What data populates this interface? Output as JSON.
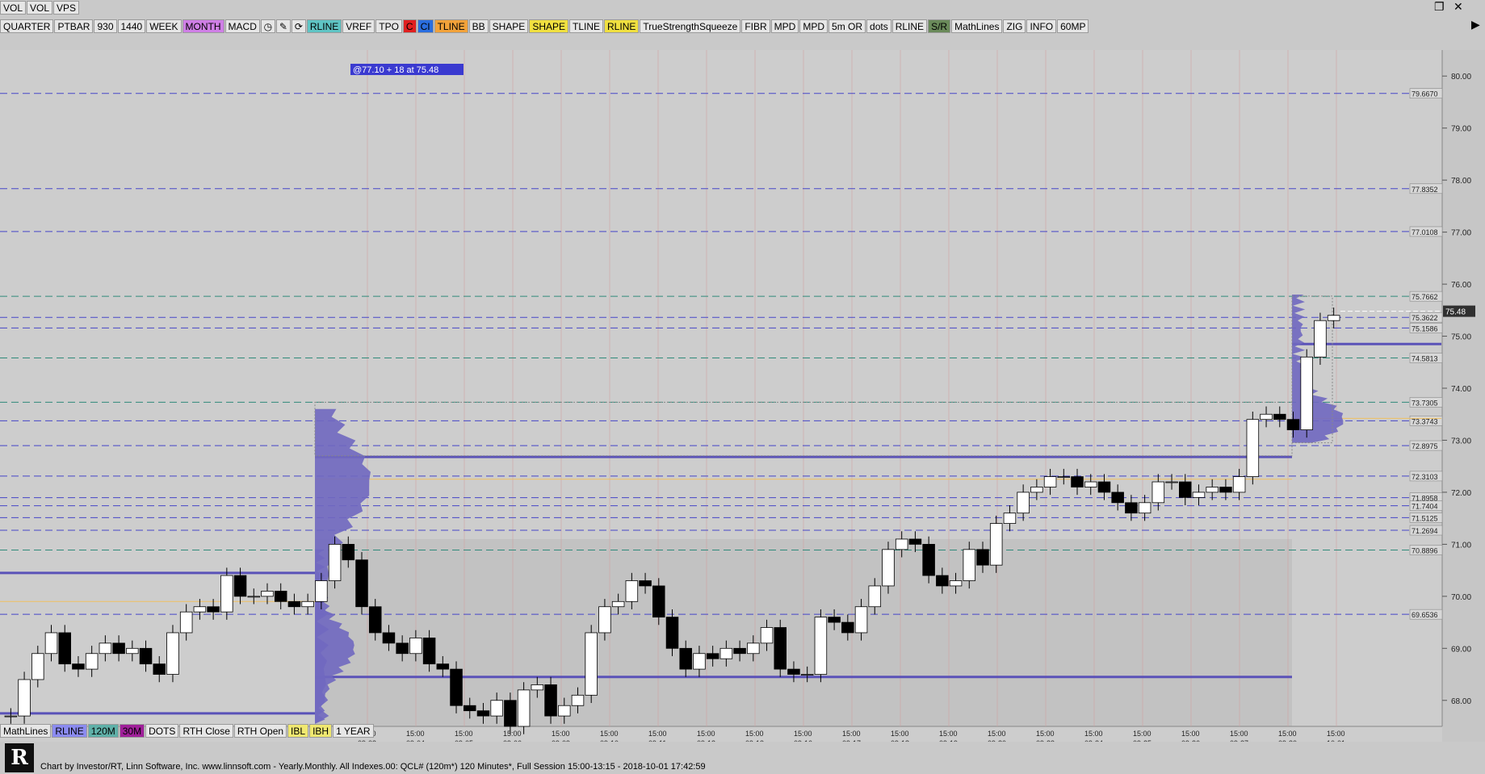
{
  "top_tabs": [
    "VOL",
    "VOL",
    "VPS"
  ],
  "toolbar": [
    {
      "label": "QUARTER",
      "color": "#e6e6e6"
    },
    {
      "label": "PTBAR",
      "color": "#e6e6e6"
    },
    {
      "label": "930",
      "color": "#e6e6e6"
    },
    {
      "label": "1440",
      "color": "#e6e6e6"
    },
    {
      "label": "WEEK",
      "color": "#e6e6e6"
    },
    {
      "label": "MONTH",
      "color": "#cf7fe6"
    },
    {
      "label": "MACD",
      "color": "#e6e6e6"
    },
    {
      "label": "",
      "color": "#e6e6e6",
      "icon": "clock-icon",
      "glyph": "◷"
    },
    {
      "label": "",
      "color": "#e6e6e6",
      "icon": "pencil-icon",
      "glyph": "✎"
    },
    {
      "label": "",
      "color": "#e6e6e6",
      "icon": "refresh-icon",
      "glyph": "⟳"
    },
    {
      "label": "RLINE",
      "color": "#5fc4c4"
    },
    {
      "label": "VREF",
      "color": "#e6e6e6"
    },
    {
      "label": "TPO",
      "color": "#e6e6e6"
    },
    {
      "label": "C",
      "color": "#e02020"
    },
    {
      "label": "CI",
      "color": "#2a6ee0"
    },
    {
      "label": "TLINE",
      "color": "#f2a23a"
    },
    {
      "label": "BB",
      "color": "#e6e6e6"
    },
    {
      "label": "SHAPE",
      "color": "#e6e6e6"
    },
    {
      "label": "SHAPE",
      "color": "#f0e040"
    },
    {
      "label": "TLINE",
      "color": "#e6e6e6"
    },
    {
      "label": "RLINE",
      "color": "#f0e040"
    },
    {
      "label": "TrueStrengthSqueeze",
      "color": "#e6e6e6"
    },
    {
      "label": "FIBR",
      "color": "#e6e6e6"
    },
    {
      "label": "MPD",
      "color": "#e6e6e6"
    },
    {
      "label": "MPD",
      "color": "#e6e6e6"
    },
    {
      "label": "5m OR",
      "color": "#e6e6e6"
    },
    {
      "label": "dots",
      "color": "#e6e6e6"
    },
    {
      "label": "RLINE",
      "color": "#e6e6e6"
    },
    {
      "label": "S/R",
      "color": "#6a8a5a"
    },
    {
      "label": "MathLines",
      "color": "#e6e6e6"
    },
    {
      "label": "ZIG",
      "color": "#e6e6e6"
    },
    {
      "label": "INFO",
      "color": "#e6e6e6"
    },
    {
      "label": "60MP",
      "color": "#e6e6e6"
    }
  ],
  "bottom_toolbar": [
    {
      "label": "MathLines",
      "color": "#e6e6e6"
    },
    {
      "label": "RLINE",
      "color": "#8b8bf0"
    },
    {
      "label": "120M",
      "color": "#5fb0a8"
    },
    {
      "label": "30M",
      "color": "#a0209a"
    },
    {
      "label": "DOTS",
      "color": "#e6e6e6"
    },
    {
      "label": "RTH Close",
      "color": "#e6e6e6"
    },
    {
      "label": "RTH Open",
      "color": "#e6e6e6"
    },
    {
      "label": "IBL",
      "color": "#f0e870"
    },
    {
      "label": "IBH",
      "color": "#f0e870"
    },
    {
      "label": "1 YEAR",
      "color": "#e6e6e6"
    }
  ],
  "annotation": "@77.10  + 18 at 75.48",
  "last_price": "75.48",
  "colors": {
    "chart_bg_upper": "#cdcdcd",
    "chart_bg_lower": "#c2c2c2",
    "dashed_blue": "#4646c8",
    "dashed_teal": "#2f8a7a",
    "profile": "#7068c0",
    "level_line": "#5a52b8",
    "poc_line": "#f0c060"
  },
  "chart_data": {
    "type": "candlestick",
    "title": "",
    "ylim": [
      67.5,
      80.5
    ],
    "y_ticks": [
      "68.00",
      "69.00",
      "70.00",
      "71.00",
      "72.00",
      "73.00",
      "74.00",
      "75.00",
      "76.00",
      "77.00",
      "78.00",
      "79.00",
      "80.00"
    ],
    "levels_blue": [
      "79.6670",
      "77.8352",
      "77.0108",
      "75.3622",
      "75.1586",
      "73.3743",
      "72.8975",
      "72.3103",
      "71.8958",
      "71.7404",
      "71.5125",
      "71.2694",
      "69.6536"
    ],
    "levels_teal": [
      "75.7662",
      "74.5813",
      "73.7305",
      "70.8896"
    ],
    "date_labels": [
      "09-03",
      "09-04",
      "09-05",
      "09-06",
      "09-09",
      "09-10",
      "09-11",
      "09-12",
      "09-13",
      "09-16",
      "09-17",
      "09-18",
      "09-19",
      "09-20",
      "09-23",
      "09-24",
      "09-25",
      "09-26",
      "09-27",
      "09-30",
      "10-01"
    ],
    "time_label": "15:00",
    "x_axis_time_labels": [
      "15:00",
      "15:00",
      "15:00",
      "15:00",
      "15:00",
      "15:00",
      "15:00",
      "15:00",
      "15:00",
      "15:00",
      "15:00",
      "15:00",
      "15:00",
      "15:00",
      "15:00",
      "15:00",
      "15:00",
      "15:00",
      "15:00",
      "15:00",
      "15:00",
      "15:00"
    ],
    "close_path": [
      67.7,
      68.4,
      68.9,
      69.3,
      68.7,
      68.6,
      68.9,
      69.1,
      68.9,
      69.0,
      68.7,
      68.5,
      69.3,
      69.7,
      69.8,
      69.7,
      70.4,
      70.0,
      70.0,
      70.1,
      69.9,
      69.8,
      69.9,
      70.3,
      71.0,
      70.7,
      69.8,
      69.3,
      69.1,
      68.9,
      69.2,
      68.7,
      68.6,
      67.9,
      67.8,
      67.7,
      68.0,
      67.5,
      68.2,
      68.3,
      67.7,
      67.9,
      68.1,
      69.3,
      69.8,
      69.9,
      70.3,
      70.2,
      69.6,
      69.0,
      68.6,
      68.9,
      68.8,
      69.0,
      68.9,
      69.1,
      69.4,
      68.6,
      68.5,
      68.5,
      69.6,
      69.5,
      69.3,
      69.8,
      70.2,
      70.9,
      71.1,
      71.0,
      70.4,
      70.2,
      70.3,
      70.9,
      70.6,
      71.4,
      71.6,
      72.0,
      72.1,
      72.3,
      72.3,
      72.1,
      72.2,
      72.0,
      71.8,
      71.6,
      71.8,
      72.2,
      72.2,
      71.9,
      72.0,
      72.1,
      72.0,
      72.3,
      73.4,
      73.5,
      73.4,
      73.2,
      74.6,
      75.3,
      75.4
    ]
  }
}
